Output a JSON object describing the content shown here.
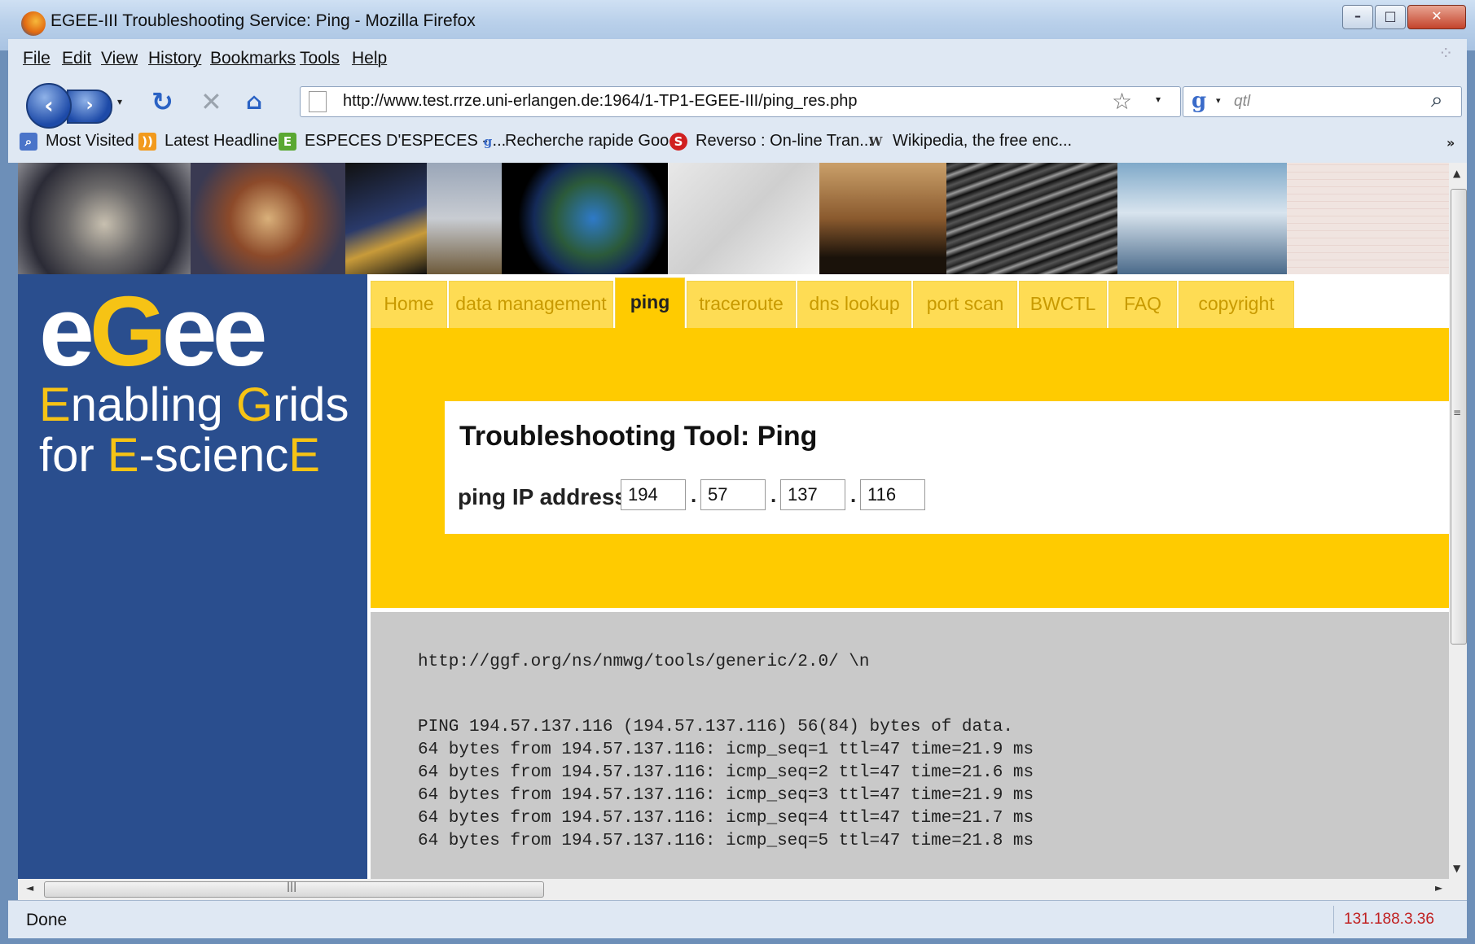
{
  "window": {
    "title": "EGEE-III Troubleshooting Service: Ping - Mozilla Firefox",
    "min_label": "–",
    "max_label": "□",
    "close_label": "✕"
  },
  "menu": [
    "File",
    "Edit",
    "View",
    "History",
    "Bookmarks",
    "Tools",
    "Help"
  ],
  "nav": {
    "url": "http://www.test.rrze.uni-erlangen.de:1964/1-TP1-EGEE-III/ping_res.php",
    "search_value": "qtl"
  },
  "bookmarks": [
    {
      "label": "Most Visited",
      "icon": "search-page-icon",
      "color": "#4a74c9"
    },
    {
      "label": "Latest Headlines",
      "icon": "rss-icon",
      "color": "#f29a1d"
    },
    {
      "label": "ESPECES D'ESPECES - ...",
      "icon": "site-e-icon",
      "color": "#5aa832"
    },
    {
      "label": "Recherche rapide Goo...",
      "icon": "google-icon",
      "color": "#3a6bc9"
    },
    {
      "label": "Reverso : On-line Tran...",
      "icon": "reverso-icon",
      "color": "#d02020"
    },
    {
      "label": "Wikipedia, the free enc...",
      "icon": "wikipedia-icon",
      "color": "#333333"
    }
  ],
  "logo": {
    "line1_a": "E",
    "line1_b": "nabling ",
    "line1_c": "G",
    "line1_d": "rids",
    "line2_a": "for ",
    "line2_b": "E",
    "line2_c": "-scienc",
    "line2_d": "E"
  },
  "tabs": [
    "Home",
    "data management",
    "ping",
    "traceroute",
    "dns lookup",
    "port scan",
    "BWCTL",
    "FAQ",
    "copyright"
  ],
  "active_tab": "ping",
  "tool": {
    "title": "Troubleshooting Tool: Ping",
    "label": "ping IP address:",
    "ip": [
      "194",
      "57",
      "137",
      "116"
    ],
    "dot": "."
  },
  "output": {
    "namespace": "http://ggf.org/ns/nmwg/tools/generic/2.0/ \\n",
    "lines": [
      "PING 194.57.137.116 (194.57.137.116) 56(84) bytes of data.",
      "64 bytes from 194.57.137.116: icmp_seq=1 ttl=47 time=21.9 ms",
      "64 bytes from 194.57.137.116: icmp_seq=2 ttl=47 time=21.6 ms",
      "64 bytes from 194.57.137.116: icmp_seq=3 ttl=47 time=21.9 ms",
      "64 bytes from 194.57.137.116: icmp_seq=4 ttl=47 time=21.7 ms",
      "64 bytes from 194.57.137.116: icmp_seq=5 ttl=47 time=21.8 ms"
    ]
  },
  "status": {
    "text": "Done",
    "ip": "131.188.3.36"
  },
  "colors": {
    "tab_yellow": "#fedc54",
    "active_yellow": "#ffcb00",
    "logo_blue": "#2a4e8e",
    "output_gray": "#c9c9c9"
  }
}
